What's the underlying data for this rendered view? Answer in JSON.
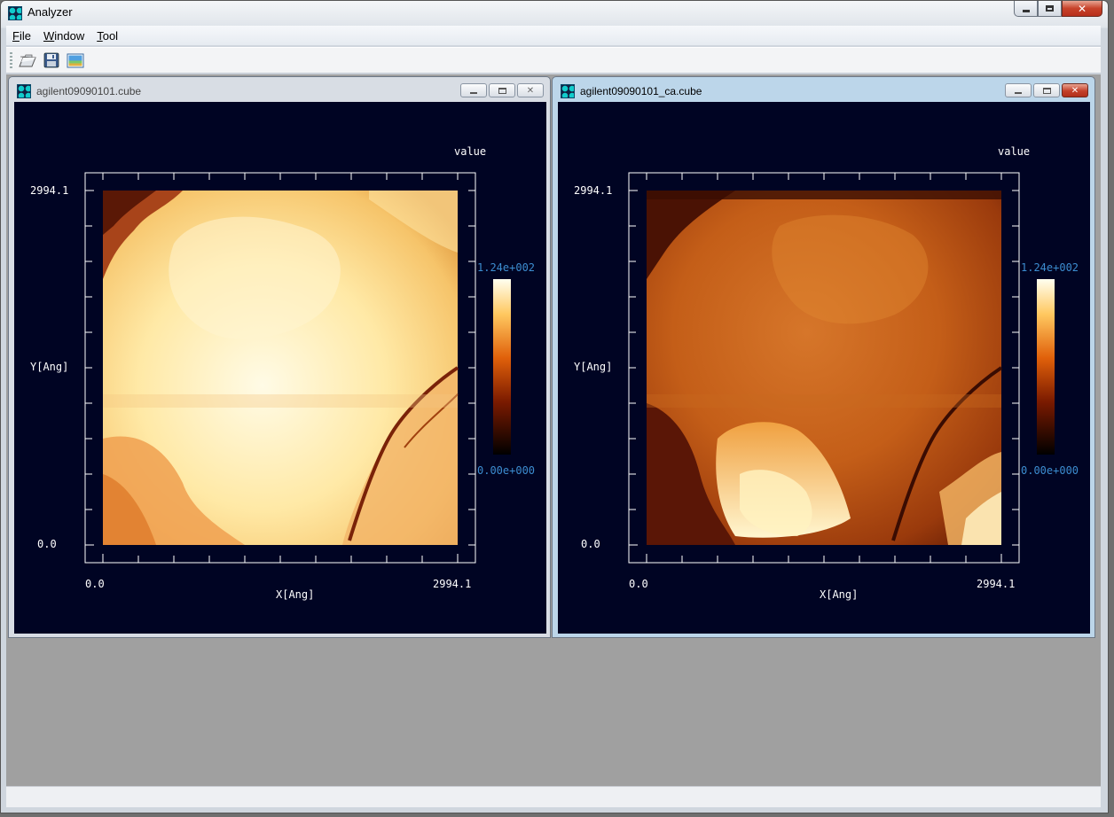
{
  "app": {
    "title": "Analyzer"
  },
  "menu": [
    {
      "mnemonic": "F",
      "rest": "ile"
    },
    {
      "mnemonic": "W",
      "rest": "indow"
    },
    {
      "mnemonic": "T",
      "rest": "ool"
    }
  ],
  "toolbar": [
    "open-folder-icon",
    "save-icon",
    "image-icon"
  ],
  "windows": [
    {
      "title": "agilent09090101.cube",
      "state": "inactive",
      "plot": {
        "value_label": "value",
        "y_label": "Y[Ang]",
        "x_label": "X[Ang]",
        "y_max": "2994.1",
        "y_min": "0.0",
        "x_min": "0.0",
        "x_max": "2994.1",
        "cb_max": "1.24e+002",
        "cb_min": "0.00e+000"
      }
    },
    {
      "title": "agilent09090101_ca.cube",
      "state": "active",
      "plot": {
        "value_label": "value",
        "y_label": "Y[Ang]",
        "x_label": "X[Ang]",
        "y_max": "2994.1",
        "y_min": "0.0",
        "x_min": "0.0",
        "x_max": "2994.1",
        "cb_max": "1.24e+002",
        "cb_min": "0.00e+000"
      }
    }
  ],
  "colors": {
    "plot_background": "#000423",
    "colorbar_label": "#3c8dd0",
    "mdi_background": "#a0a0a0"
  }
}
